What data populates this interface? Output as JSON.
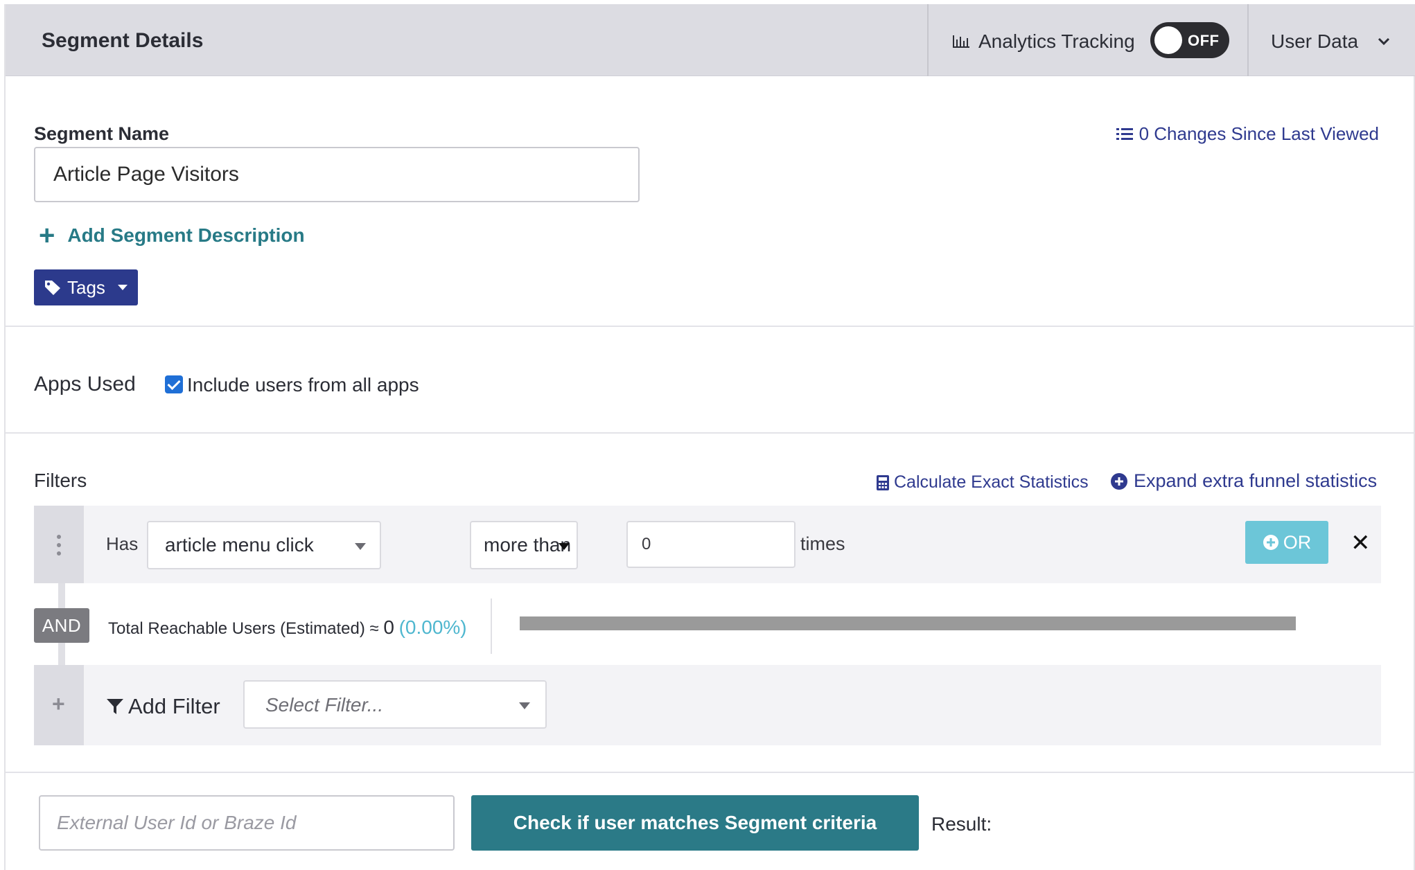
{
  "header": {
    "title": "Segment Details",
    "analytics_label": "Analytics Tracking",
    "toggle_state": "OFF",
    "user_data_label": "User Data"
  },
  "segment": {
    "name_label": "Segment Name",
    "name_value": "Article Page Visitors",
    "changes_text": "0 Changes Since Last Viewed",
    "add_description": "Add Segment Description",
    "tags_label": "Tags"
  },
  "apps": {
    "label": "Apps Used",
    "include_all_label": "Include users from all apps",
    "include_all_checked": true
  },
  "filters": {
    "label": "Filters",
    "calculate_label": "Calculate Exact Statistics",
    "expand_label": "Expand extra funnel statistics",
    "rows": [
      {
        "has_label": "Has",
        "event": "article menu click",
        "comparator": "more than",
        "count": "0",
        "times_label": "times",
        "or_label": "OR"
      }
    ],
    "and_label": "AND",
    "reachable_label": "Total Reachable Users (Estimated) ≈",
    "reachable_count": "0",
    "reachable_pct": "(0.00%)",
    "add_filter_label": "Add Filter",
    "select_filter_placeholder": "Select Filter..."
  },
  "check": {
    "input_placeholder": "External User Id or Braze Id",
    "button_label": "Check if user matches Segment criteria",
    "result_label": "Result:"
  },
  "colors": {
    "primary_navy": "#2c3a8c",
    "teal": "#2b7a87",
    "link_blue": "#2f3a8f",
    "or_button": "#6cc6d8",
    "checkbox": "#1f6fd6"
  }
}
